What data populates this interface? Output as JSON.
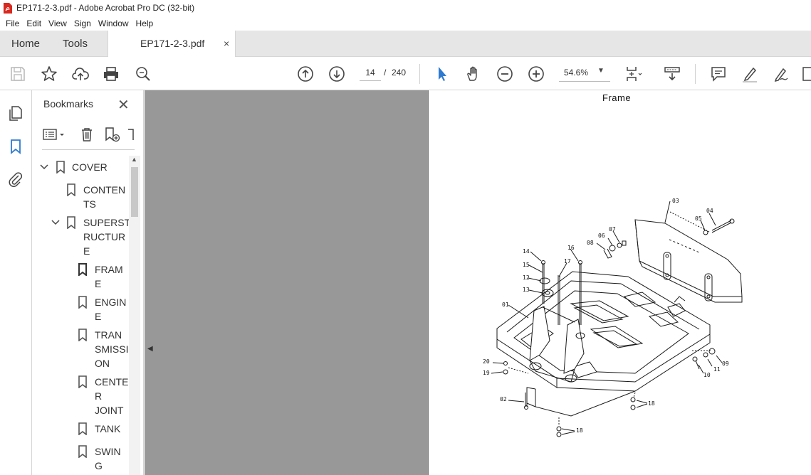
{
  "window": {
    "title": "EP171-2-3.pdf - Adobe Acrobat Pro DC (32-bit)"
  },
  "menu": [
    "File",
    "Edit",
    "View",
    "Sign",
    "Window",
    "Help"
  ],
  "tabs": {
    "home": "Home",
    "tools": "Tools",
    "document": "EP171-2-3.pdf",
    "close": "×"
  },
  "toolbar": {
    "page_current": "14",
    "page_separator": "/",
    "page_total": "240",
    "zoom": "54.6%"
  },
  "bookmarks": {
    "title": "Bookmarks",
    "close": "✕",
    "items": [
      {
        "label": "COVER",
        "level": 0,
        "expanded": true
      },
      {
        "label": "CONTEN\nTS",
        "level": 1
      },
      {
        "label": "SUPERST\nRUCTUR\nE",
        "level": 1,
        "expanded": true
      },
      {
        "label": "FRAM\nE",
        "level": 2,
        "selected": true
      },
      {
        "label": "ENGIN\nE",
        "level": 2
      },
      {
        "label": "TRAN\nSMISSI\nON",
        "level": 2
      },
      {
        "label": "CENTE\nR\nJOINT",
        "level": 2
      },
      {
        "label": "TANK",
        "level": 2
      },
      {
        "label": "SWIN\nG",
        "level": 2
      }
    ]
  },
  "document": {
    "heading": "Frame",
    "callouts": [
      "03",
      "04",
      "05",
      "06",
      "07",
      "08",
      "14",
      "16",
      "15",
      "17",
      "12",
      "13",
      "01",
      "20",
      "19",
      "02",
      "09",
      "11",
      "10",
      "18",
      "18"
    ]
  },
  "colors": {
    "accent": "#2e7ad1",
    "pdf_red": "#d9281e",
    "doc_background": "#989898"
  }
}
